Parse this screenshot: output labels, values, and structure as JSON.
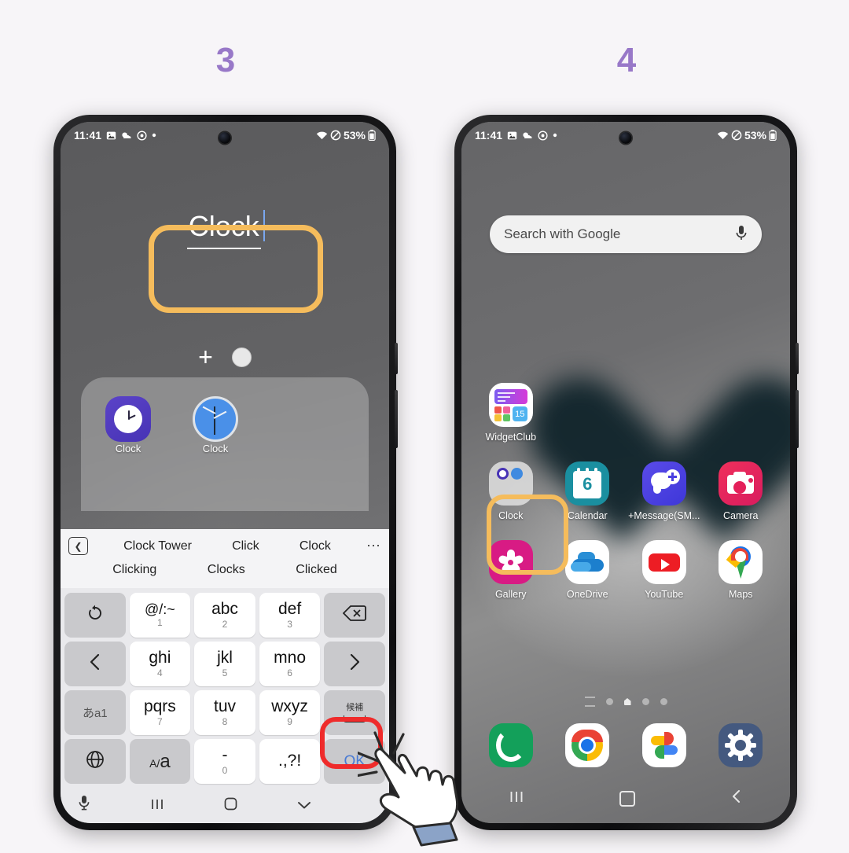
{
  "steps": {
    "left": "3",
    "right": "4"
  },
  "colors": {
    "background": "#f7f5f8",
    "step_number": "#9878c8",
    "highlight_orange": "#f5bc5c",
    "highlight_red": "#ef2b2b",
    "key_text_ok": "#4a7bd4"
  },
  "status_bar": {
    "time": "11:41",
    "left_icons": [
      "image-icon",
      "weather-icon",
      "alarm-icon",
      "dot-icon"
    ],
    "right_icons": [
      "wifi-icon",
      "mute-icon",
      "battery-icon"
    ],
    "battery": "53%"
  },
  "phone_left": {
    "rename_field": {
      "value": "Clock",
      "caret": true
    },
    "folder_toolbar": {
      "add_label": "+",
      "color_dot": "color-circle"
    },
    "folder_apps": [
      {
        "label": "Clock",
        "icon": "samsung-clock-icon"
      },
      {
        "label": "Clock",
        "icon": "google-clock-icon"
      }
    ],
    "keyboard": {
      "suggestions_row1": [
        "Clock Tower",
        "Click",
        "Clock"
      ],
      "suggestions_row2": [
        "Clicking",
        "Clocks",
        "Clicked"
      ],
      "back_icon": "chevron-left-boxed-icon",
      "more_icon": "ellipsis-icon",
      "keys": [
        {
          "name": "undo",
          "main": "↺",
          "sub": "",
          "type": "fn",
          "icon": "undo-icon"
        },
        {
          "name": "symbols",
          "main": "@/:~",
          "sub": "1",
          "type": "char"
        },
        {
          "name": "abc",
          "main": "abc",
          "sub": "2",
          "type": "char"
        },
        {
          "name": "def",
          "main": "def",
          "sub": "3",
          "type": "char"
        },
        {
          "name": "backspace",
          "main": "⌫",
          "sub": "",
          "type": "fn",
          "icon": "backspace-icon"
        },
        {
          "name": "cursor-left",
          "main": "‹",
          "sub": "",
          "type": "fn",
          "icon": "chevron-left-icon"
        },
        {
          "name": "ghi",
          "main": "ghi",
          "sub": "4",
          "type": "char"
        },
        {
          "name": "jkl",
          "main": "jkl",
          "sub": "5",
          "type": "char"
        },
        {
          "name": "mno",
          "main": "mno",
          "sub": "6",
          "type": "char"
        },
        {
          "name": "cursor-right",
          "main": "›",
          "sub": "",
          "type": "fn",
          "icon": "chevron-right-icon"
        },
        {
          "name": "input-mode",
          "main": "あa1",
          "sub": "",
          "type": "fn"
        },
        {
          "name": "pqrs",
          "main": "pqrs",
          "sub": "7",
          "type": "char"
        },
        {
          "name": "tuv",
          "main": "tuv",
          "sub": "8",
          "type": "char"
        },
        {
          "name": "wxyz",
          "main": "wxyz",
          "sub": "9",
          "type": "char"
        },
        {
          "name": "candidate",
          "main": "候補",
          "sub": "",
          "type": "fn"
        },
        {
          "name": "language",
          "main": "⊕",
          "sub": "",
          "type": "fn",
          "icon": "globe-icon"
        },
        {
          "name": "case-toggle",
          "main": "A/a",
          "sub": "",
          "type": "fn"
        },
        {
          "name": "dash",
          "main": "-",
          "sub": "0",
          "type": "char"
        },
        {
          "name": "punctuation",
          "main": ".,?!",
          "sub": "",
          "type": "char"
        },
        {
          "name": "ok",
          "main": "OK",
          "sub": "",
          "type": "fn"
        }
      ],
      "bottom_bar": [
        "mic-icon",
        "recents-icon",
        "home-icon",
        "hide-keyboard-icon"
      ]
    }
  },
  "phone_right": {
    "search": {
      "placeholder": "Search with Google",
      "mic_icon": "mic-icon"
    },
    "apps": [
      {
        "label": "WidgetClub",
        "icon": "widgetclub-icon"
      },
      {
        "label": "",
        "icon": "empty"
      },
      {
        "label": "",
        "icon": "empty"
      },
      {
        "label": "",
        "icon": "empty"
      },
      {
        "label": "Clock",
        "icon": "clock-folder-icon"
      },
      {
        "label": "Calendar",
        "icon": "calendar-icon",
        "badge": "6"
      },
      {
        "label": "+Message(SM...",
        "icon": "plus-message-icon"
      },
      {
        "label": "Camera",
        "icon": "camera-icon"
      },
      {
        "label": "Gallery",
        "icon": "gallery-icon"
      },
      {
        "label": "OneDrive",
        "icon": "onedrive-icon"
      },
      {
        "label": "YouTube",
        "icon": "youtube-icon"
      },
      {
        "label": "Maps",
        "icon": "maps-icon"
      }
    ],
    "page_indicator": {
      "count": 5,
      "active_index": 2
    },
    "dock": [
      {
        "label": "",
        "icon": "phone-icon"
      },
      {
        "label": "",
        "icon": "chrome-icon"
      },
      {
        "label": "",
        "icon": "google-photos-icon"
      },
      {
        "label": "",
        "icon": "settings-icon"
      }
    ],
    "navbar": [
      "recents-icon",
      "home-icon",
      "back-icon"
    ]
  },
  "cursor": {
    "icon": "pointing-hand-cursor",
    "target": "ok-key"
  }
}
